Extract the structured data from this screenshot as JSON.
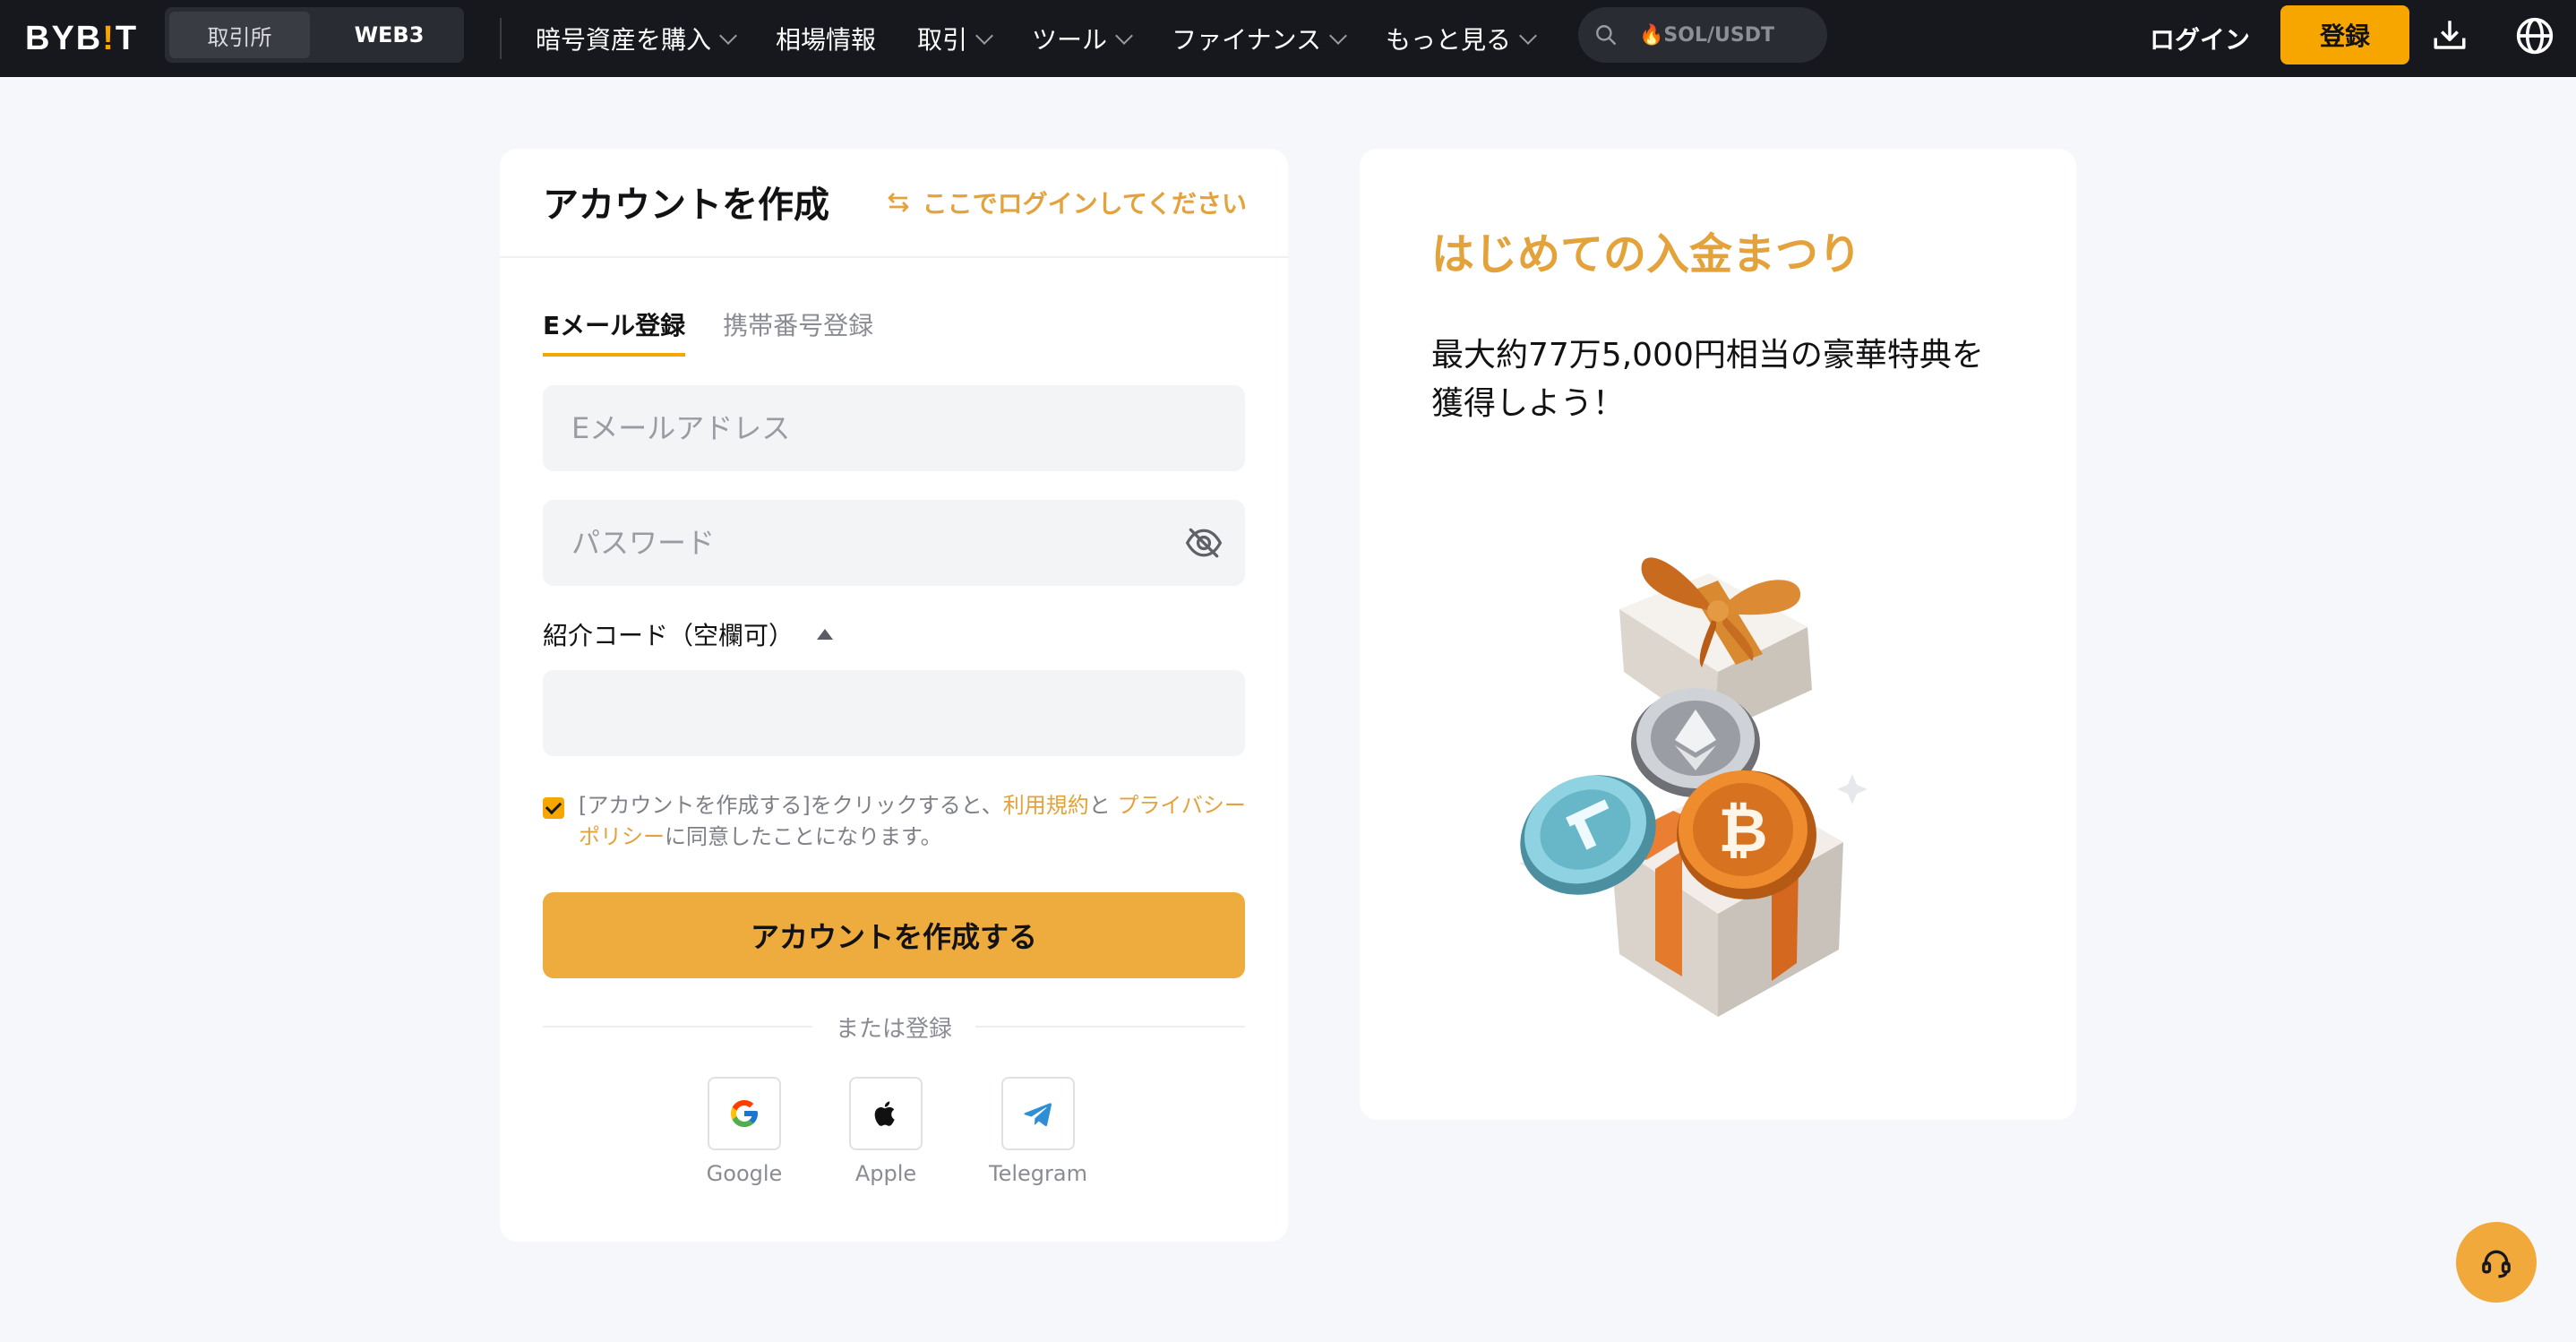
{
  "header": {
    "logo_left": "BYB",
    "logo_bang": "!",
    "logo_right": "T",
    "mode_tabs": [
      "取引所",
      "WEB3"
    ],
    "nav_items": [
      "暗号資産を購入",
      "相場情報",
      "取引",
      "ツール",
      "ファイナンス",
      "もっと見る"
    ],
    "search_text": "🔥SOL/USDT",
    "login_label": "ログイン",
    "register_label": "登録"
  },
  "form": {
    "title": "アカウントを作成",
    "login_link": "ここでログインしてください",
    "tabs": [
      "Eメール登録",
      "携帯番号登録"
    ],
    "email_placeholder": "Eメールアドレス",
    "password_placeholder": "パスワード",
    "referral_label": "紹介コード（空欄可）",
    "referral_value": "",
    "agree_prefix": "[アカウントを作成する]をクリックすると、",
    "agree_terms": "利用規約",
    "agree_and": "と ",
    "agree_privacy": "プライバシーポリシー",
    "agree_suffix": "に同意したことになります。",
    "agree_checked": true,
    "submit_label": "アカウントを作成する",
    "or_label": "または登録",
    "social": [
      "Google",
      "Apple",
      "Telegram"
    ]
  },
  "promo": {
    "title": "はじめての入金まつり",
    "text": "最大約77万5,000円相当の豪華特典を獲得しよう！"
  },
  "colors": {
    "accent": "#f7a600",
    "accent_text": "#e3a23a",
    "topbar": "#17181e",
    "page_bg": "#f5f7fa"
  },
  "icons": [
    "search-icon",
    "download-icon",
    "globe-icon",
    "swap-icon",
    "eye-off-icon",
    "caret-up-icon",
    "google-icon",
    "apple-icon",
    "telegram-icon",
    "headset-icon"
  ]
}
